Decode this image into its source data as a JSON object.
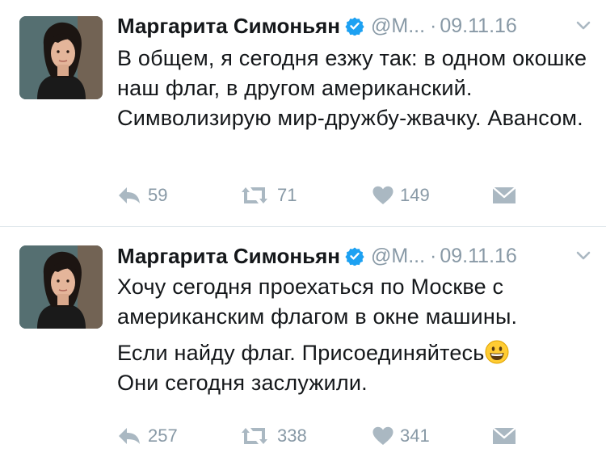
{
  "tweets": [
    {
      "author_name": "Маргарита Симоньян",
      "handle": "@M...",
      "date": "09.11.16",
      "paragraphs": [
        "В общем, я сегодня езжу так: в одном окошке наш флаг, в другом американский. Символизирую мир-дружбу-жвачку. Авансом."
      ],
      "replies": "59",
      "retweets": "71",
      "likes": "149"
    },
    {
      "author_name": "Маргарита Симоньян",
      "handle": "@M...",
      "date": "09.11.16",
      "paragraphs": [
        "Хочу сегодня проехаться по Москве с американским флагом в окне машины.",
        "Если найду флаг. Присоединяйтесь",
        "Они сегодня заслужили."
      ],
      "replies": "257",
      "retweets": "338",
      "likes": "341"
    }
  ],
  "icons": {
    "verified": "verified-badge-icon",
    "caret": "chevron-down-icon",
    "reply": "reply-icon",
    "retweet": "retweet-icon",
    "like": "heart-icon",
    "dm": "envelope-icon",
    "emoji": "grinning-face-emoji"
  },
  "colors": {
    "text": "#14171a",
    "muted": "#8899a6",
    "verified": "#1da1f2",
    "divider": "#e1e8ed",
    "icon": "#aab8c2"
  }
}
